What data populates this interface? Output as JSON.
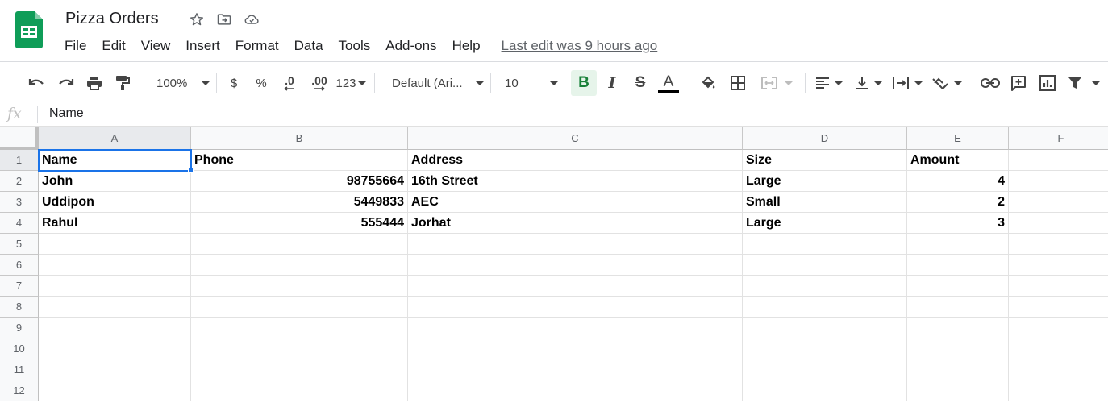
{
  "app": {
    "title": "Pizza Orders",
    "menu": [
      "File",
      "Edit",
      "View",
      "Insert",
      "Format",
      "Data",
      "Tools",
      "Add-ons",
      "Help"
    ],
    "last_edit": "Last edit was 9 hours ago",
    "accent_color": "#1a73e8",
    "logo_color": "#0f9d58"
  },
  "toolbar": {
    "zoom": "100%",
    "currency": "$",
    "percent": "%",
    "decrease_decimal": ".0",
    "increase_decimal": ".00",
    "more_formats": "123",
    "font": "Default (Ari...",
    "font_size": "10",
    "bold": "B",
    "italic": "I",
    "strike": "S",
    "text_color": "A"
  },
  "formula_bar": {
    "fx": "fx",
    "value": "Name"
  },
  "sheet": {
    "columns": [
      "A",
      "B",
      "C",
      "D",
      "E",
      "F"
    ],
    "rows": [
      "1",
      "2",
      "3",
      "4",
      "5",
      "6",
      "7",
      "8",
      "9",
      "10",
      "11",
      "12"
    ],
    "selected_cell": "A1",
    "data": [
      [
        "Name",
        "Phone",
        "Address",
        "Size",
        "Amount",
        ""
      ],
      [
        "John",
        "98755664",
        "16th Street",
        "Large",
        "4",
        ""
      ],
      [
        "Uddipon",
        "5449833",
        "AEC",
        "Small",
        "2",
        ""
      ],
      [
        "Rahul",
        "555444",
        "Jorhat",
        "Large",
        "3",
        ""
      ]
    ]
  }
}
